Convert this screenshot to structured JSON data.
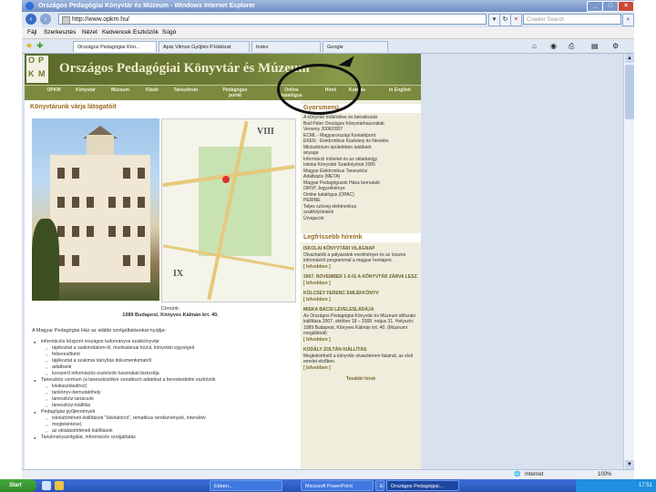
{
  "window": {
    "title": "Országos Pedagógiai Könyvtár és Múzeum - Windows Internet Explorer",
    "url": "http://www.opkm.hu/",
    "search_placeholder": "Crawler Search"
  },
  "menu": [
    "Fájl",
    "Szerkesztés",
    "Nézet",
    "Kedvencek",
    "Eszközök",
    "Súgó"
  ],
  "tabs": [
    {
      "label": "Országos Pedagógiai Kön..."
    },
    {
      "label": "Apár Vilmos Gyűjtés P.Hálózat"
    },
    {
      "label": "Index"
    },
    {
      "label": "Google"
    }
  ],
  "site": {
    "logo_letters": [
      "O",
      "P",
      "K",
      "M"
    ],
    "title": "Országos Pedagógiai Könyvtár és Múzeum",
    "nav": [
      "OPKM",
      "Könyvtár",
      "Múzeum",
      "Kiadó",
      "Tanszékvár",
      "Pedagógus portál",
      "Online katalógus",
      "Hírek",
      "Kutatás",
      "In English"
    ],
    "main_title": "Könyvtárunk várja látogatóit",
    "map_labels": [
      "VIII",
      "IX"
    ],
    "caption_lines": [
      "Címünk:",
      "1089 Budapest, Könyves Kálmán krt. 40."
    ],
    "intro": "A Magyar Pedagógiai Ház az alábbi szolgáltatásokat nyújtja:",
    "list": [
      {
        "level": 1,
        "text": "információs központ országos tudományos szakkönyvtár"
      },
      {
        "level": 2,
        "text": "tájékoztat a szakirodalom-ól, munkatársai közül, könyvtári egységeit"
      },
      {
        "level": 2,
        "text": "felkeresőként"
      },
      {
        "level": 2,
        "text": "tájékoztat a szakmai irányítás dokumentumairól"
      },
      {
        "level": 2,
        "text": "adatbank"
      },
      {
        "level": 2,
        "text": "korszerű információs eszközök használati biztosítja"
      },
      {
        "level": 1,
        "text": "Taneszköz centrum (a taneszközökre vonatkozó adatokat a kereskedelmi eszközök"
      },
      {
        "level": 2,
        "text": "kiválasztásához)"
      },
      {
        "level": 2,
        "text": "tankönyv-bemutatóhely"
      },
      {
        "level": 2,
        "text": "taneszköz-tanácsok"
      },
      {
        "level": 2,
        "text": "taneszköz-kiállítás"
      },
      {
        "level": 1,
        "text": "Pedagógiai gyűjtemények"
      },
      {
        "level": 2,
        "text": "iskolatörténeti kiállítások \"Iskolatörzs\", tematikus rendezvények, interaktív"
      },
      {
        "level": 2,
        "text": "megtekintése)"
      },
      {
        "level": 2,
        "text": "az oktatástörténeti kiállítások"
      },
      {
        "level": 1,
        "text": "Tanulmányszolgálat, információs szolgáltatás"
      }
    ],
    "sidebar": {
      "section_title": "Gyorsmenü",
      "links": [
        "A könyvtár működése és beiratkozás",
        "Bod Péter Országos Könyvtárhasználati",
        "Verseny 2006/2007",
        "ECML - Magyarországi Kontaktpont",
        "EKEN - Elektronikus Kiadvány és Nevelés",
        "Minisztérium épületében található",
        "anyaga",
        "Információ művelet és az oktatásügy",
        "Iskolai Könyvtári Szakfolyóirat 2005",
        "Magyar Elektronikus Taneszköz",
        "Adatbázis (META)",
        "Magyar Pedagógusok Háza bemutató",
        "OKNY Jegyzéklénye",
        "Online katalógus (OPAC)",
        "PERINE",
        "Teljes szöveg elektronikus",
        "szakfolyóiratok",
        "Úrvajacstr"
      ],
      "news_title": "Legfrissebb híreink",
      "news": [
        {
          "title": "ISKOLAI KÖNYVTÁRI VILÁGNAP",
          "body": "Olvashatók a pályázatok eredményei és az összes információt programmal a magyar honlapon.",
          "more": "[ bővebben ]"
        },
        {
          "title": "2007. NOVEMBER 1-5-IG A KÖNYVTÁR ZÁRVA LESZ.",
          "body": "",
          "more": "[ bővebben ]"
        },
        {
          "title": "KÖLCSEY FERENC EMLÉKKÖNYV",
          "body": "",
          "more": "[ bővebben ]"
        },
        {
          "title": "MISKA BÁCSI LEVELESLÁDÁJA",
          "body": "Az Országos Pedagógiai Könyvtár és Múzeum időszaki kiállítása 2007. október 18 – 2008. május 31. Helyszín: 1089 Budapest, Könyves Kálmán krt. 40. (Múzeumi megállónál)",
          "more": "[ bővebben ]"
        },
        {
          "title": "KODÁLY ZOLTÁN KIÁLLÍTÁS",
          "body": "Megtekinthető a könyvtár olvasóterem falainál, az első emelet elsőben.",
          "more": "[ bővebben ]"
        }
      ],
      "more_news": "További hírek"
    }
  },
  "status": {
    "zone": "Internet",
    "zoom": "100%"
  },
  "taskbar": {
    "start": "Start",
    "tasks": [
      "Ebben...",
      "Microsoft PowerPoint",
      "Ebben...",
      "Országos Pedagógiai..."
    ],
    "time": "17:51"
  }
}
